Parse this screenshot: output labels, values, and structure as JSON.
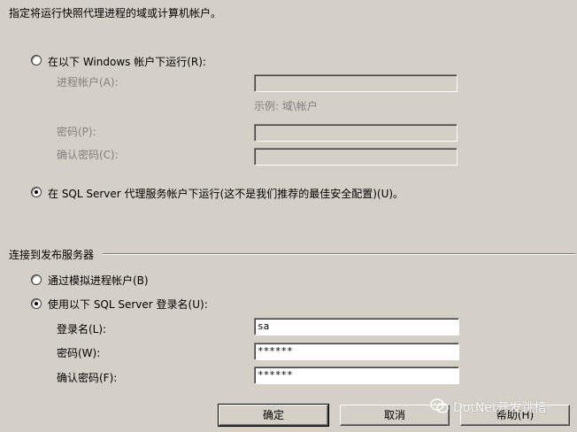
{
  "header": {
    "instruction": "指定将运行快照代理进程的域或计算机帐户。"
  },
  "agent_account": {
    "option_windows": "在以下 Windows 帐户下运行(R):",
    "process_account_label": "进程帐户(A):",
    "example_hint": "示例: 域\\帐户",
    "password_label": "密码(P):",
    "confirm_password_label": "确认密码(C):",
    "option_sql_agent": "在 SQL Server 代理服务帐户下运行(这不是我们推荐的最佳安全配置)(U)。"
  },
  "publisher": {
    "section_title": "连接到发布服务器",
    "option_impersonate": "通过模拟进程帐户(B)",
    "option_sql_login": "使用以下 SQL Server 登录名(U):",
    "login_label": "登录名(L):",
    "login_value": "sa",
    "password_label": "密码(W):",
    "password_value": "******",
    "confirm_password_label": "确认密码(F):",
    "confirm_password_value": "******"
  },
  "buttons": {
    "ok": "确定",
    "cancel": "取消",
    "help": "帮助(H)"
  },
  "watermark": {
    "text": "DotNet开发跳槽"
  },
  "colors": {
    "dialog_bg": "#d4d0c8",
    "disabled_text": "#808080"
  }
}
